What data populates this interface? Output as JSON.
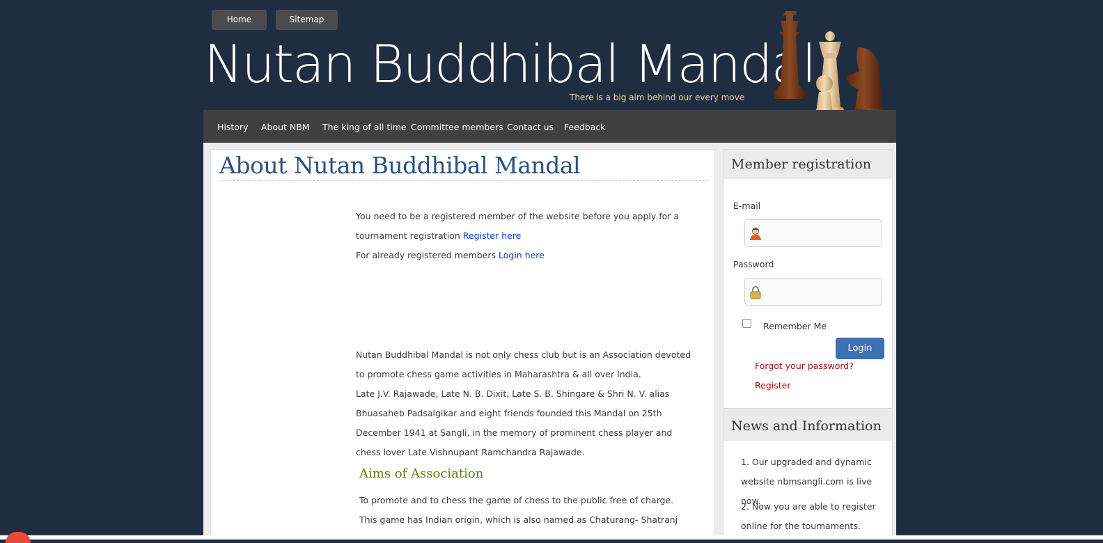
{
  "header": {
    "buttons": {
      "home": "Home",
      "sitemap": "Sitemap"
    },
    "title": "Nutan Buddhibal Mandal",
    "tagline": "There is a big aim behind our every move"
  },
  "nav": {
    "items": [
      "History",
      "About NBM",
      "The king of all time",
      "Committee members",
      "Contact us",
      "Feedback"
    ]
  },
  "main": {
    "title": "About Nutan Buddhibal Mandal",
    "notice": {
      "text1": "You need to be a registered member of the website before you apply for a tournament registration",
      "register_link": "Register here",
      "text2": "For already registered members",
      "login_link": "Login here"
    },
    "about": {
      "para1": "Nutan Buddhibal Mandal is not only chess club but is an Association devoted to promote chess game activities in Maharashtra & all over India.",
      "para2": "Late J.V. Rajawade, Late N. B. Dixit, Late S. B. Shingare & Shri N. V. alias Bhuasaheb Padsalgikar and eight friends founded this Mandal on 25th December 1941 at Sangli, in the memory of prominent chess player and chess lover Late Vishnupant Ramchandra Rajawade."
    },
    "aims": {
      "heading": "Aims of Association",
      "text": "To promote and to chess the game of chess to the public free of charge. This game has Indian origin, which is also named as Chaturang- Shatranj"
    }
  },
  "sidebar": {
    "registration": {
      "heading": "Member registration",
      "email_label": "E-mail",
      "password_label": "Password",
      "remember_label": "Remember Me",
      "login_button": "Login",
      "forgot_link": "Forgot your password?",
      "register_link": "Register"
    },
    "news": {
      "heading": "News and Information",
      "items": [
        "1. Our upgraded and dynamic website nbmsangli.com is live now.",
        "2. Now you are able to register online for the tournaments."
      ]
    }
  },
  "colors": {
    "background": "#1f2d40",
    "nav_bar": "#404040",
    "title_blue": "#2a5185",
    "link_blue": "#0c3cd6",
    "aims_green": "#5b7d1b",
    "sidebar_link_red": "#a5120e",
    "login_button": "#3f70b4",
    "tagline": "#f3d9a3"
  },
  "icons": [
    "user-icon",
    "lock-icon",
    "chess-pieces-image"
  ]
}
